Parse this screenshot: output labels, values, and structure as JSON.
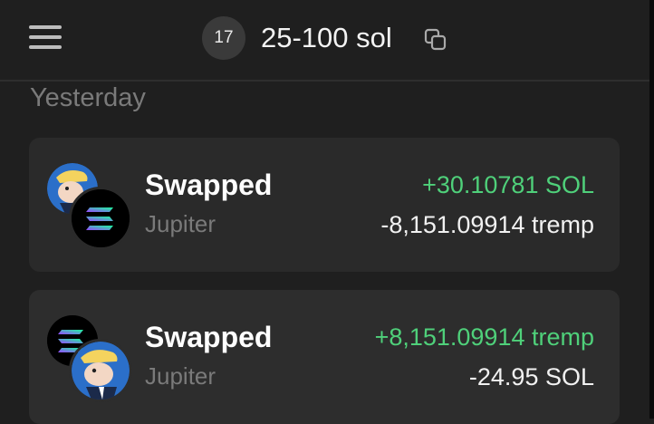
{
  "header": {
    "badge_number": "17",
    "wallet_name": "25-100 sol"
  },
  "section": {
    "label": "Yesterday"
  },
  "transactions": [
    {
      "title": "Swapped",
      "source": "Jupiter",
      "amount_in": "+30.10781 SOL",
      "amount_out": "-8,151.09914 tremp",
      "front_icon": "solana-token-icon",
      "back_icon": "tremp-token-icon"
    },
    {
      "title": "Swapped",
      "source": "Jupiter",
      "amount_in": "+8,151.09914 tremp",
      "amount_out": "-24.95 SOL",
      "front_icon": "tremp-token-icon",
      "back_icon": "solana-token-icon"
    }
  ],
  "colors": {
    "background": "#1f1f1f",
    "card": "#2a2a2a",
    "positive": "#4fd07a",
    "muted": "#7a7a7a"
  }
}
